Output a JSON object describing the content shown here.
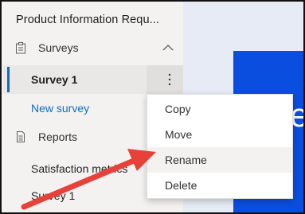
{
  "app": {
    "title": "Product Information Requ..."
  },
  "sections": {
    "surveys": {
      "label": "Surveys",
      "icon": "clipboard-icon",
      "expanded": true
    },
    "reports": {
      "label": "Reports",
      "icon": "document-icon"
    }
  },
  "surveys_list": {
    "selected_item": "Survey 1",
    "new_survey_link": "New survey"
  },
  "reports_list": {
    "item_1": "Satisfaction metrics",
    "item_2": "Survey 1"
  },
  "context_menu": {
    "items": [
      "Copy",
      "Move",
      "Rename",
      "Delete"
    ],
    "highlighted": "Rename"
  },
  "canvas": {
    "hero_text": "e"
  },
  "colors": {
    "accent": "#0f6cbd",
    "hero_blue": "#0a4ee0",
    "annotation_red": "#e8413a",
    "nav_bg": "#f3f2f1"
  }
}
